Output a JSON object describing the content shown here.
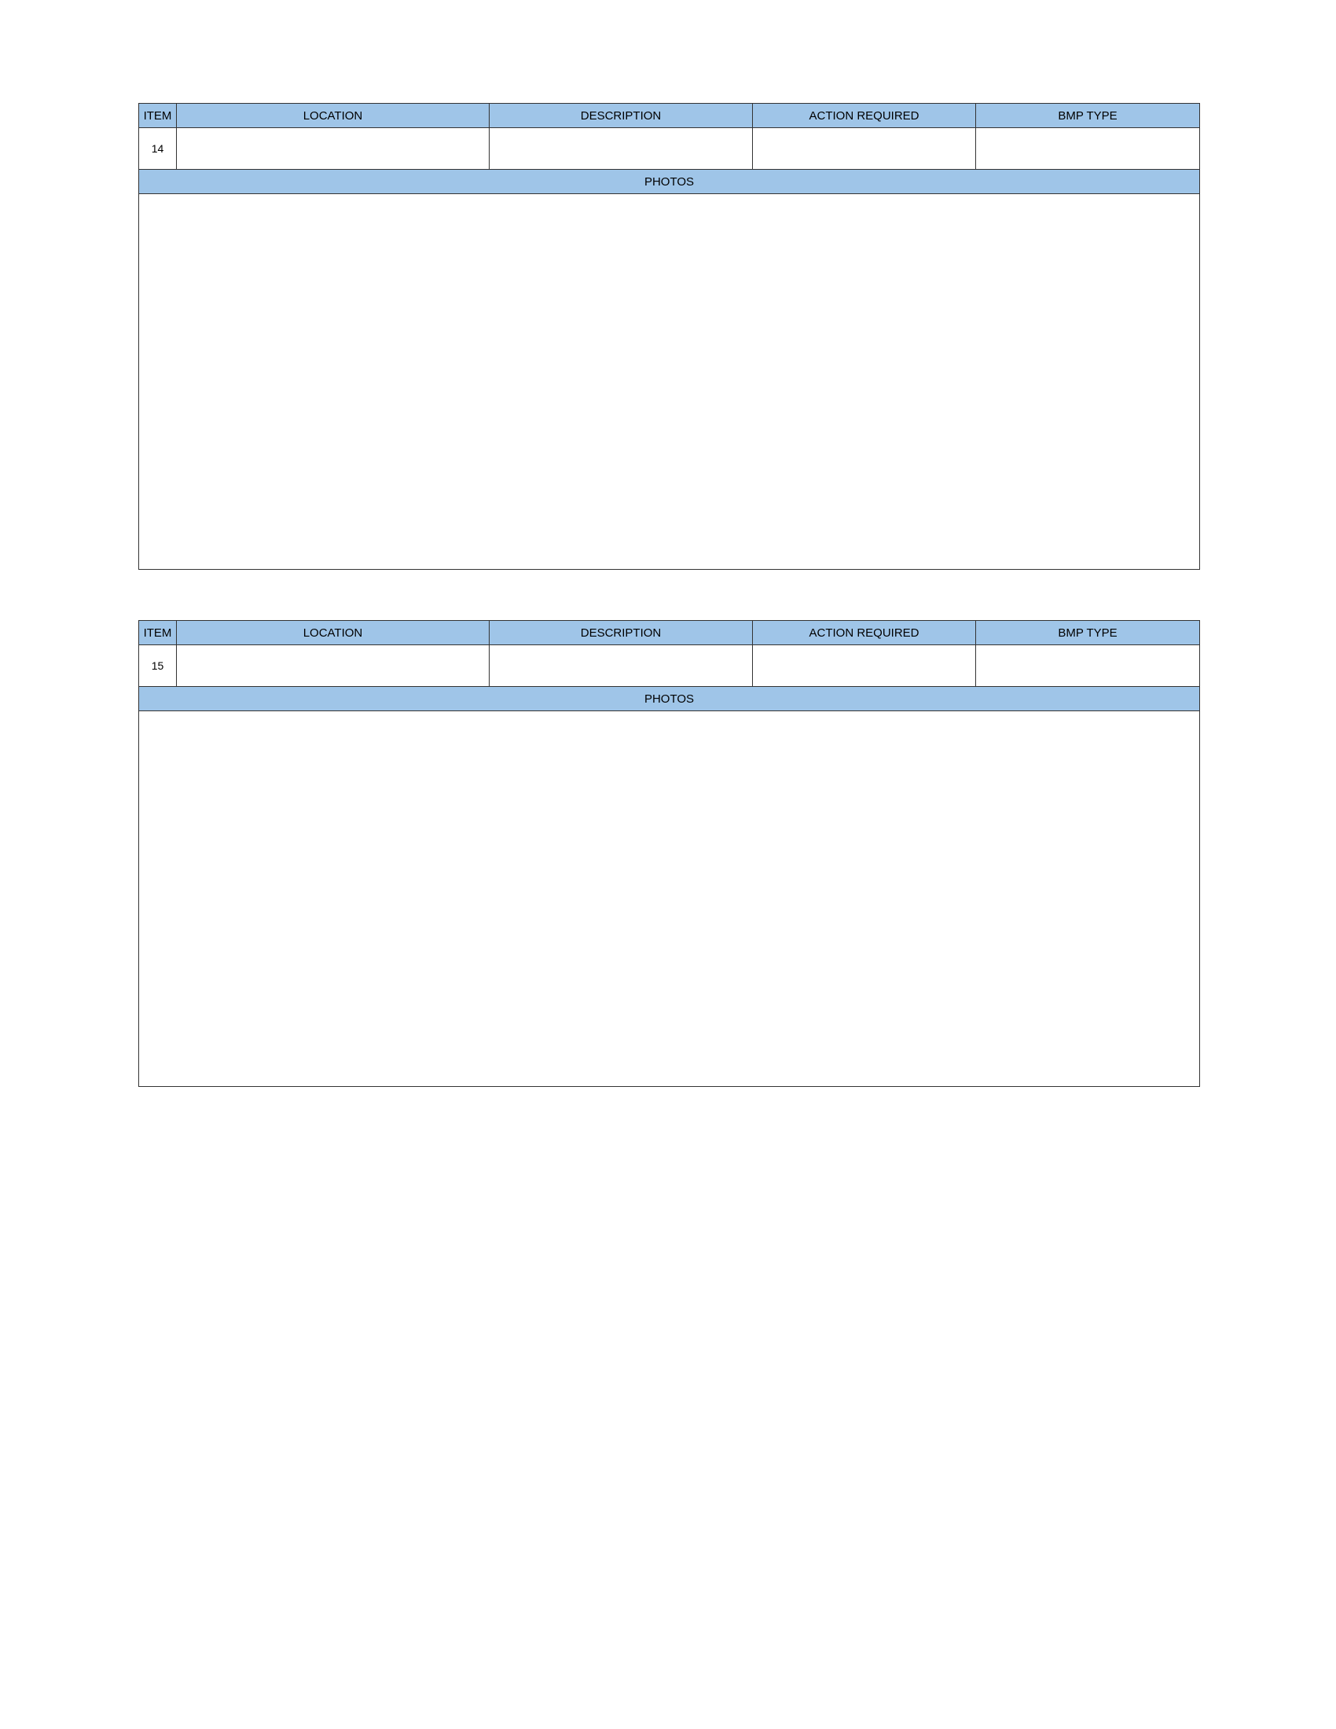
{
  "columns": [
    "ITEM",
    "LOCATION",
    "DESCRIPTION",
    "ACTION REQUIRED",
    "BMP TYPE"
  ],
  "photos_label": "PHOTOS",
  "colors": {
    "header_fill": "#9fc5e8",
    "border": "#333333"
  },
  "entries": [
    {
      "item": "14",
      "location": "",
      "description": "",
      "action_required": "",
      "bmp_type": ""
    },
    {
      "item": "15",
      "location": "",
      "description": "",
      "action_required": "",
      "bmp_type": ""
    }
  ]
}
